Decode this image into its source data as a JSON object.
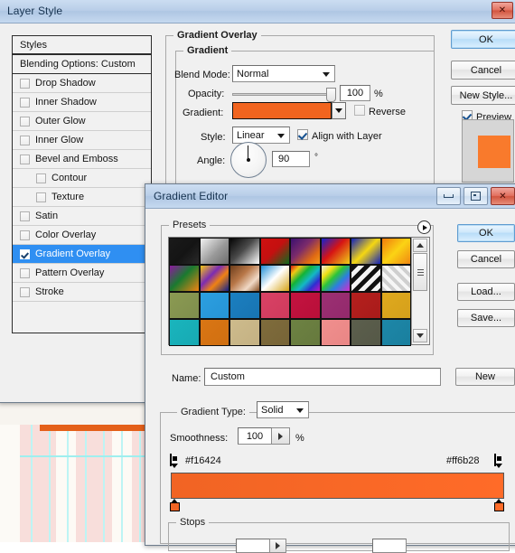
{
  "background": {
    "name": "photoshop-canvas-pinstripe"
  },
  "layer_style": {
    "title": "Layer Style",
    "close_icon": "close-icon",
    "styles_header": "Styles",
    "blending_options": "Blending Options: Custom",
    "effects": [
      {
        "label": "Drop Shadow",
        "checked": false,
        "indent": false
      },
      {
        "label": "Inner Shadow",
        "checked": false,
        "indent": false
      },
      {
        "label": "Outer Glow",
        "checked": false,
        "indent": false
      },
      {
        "label": "Inner Glow",
        "checked": false,
        "indent": false
      },
      {
        "label": "Bevel and Emboss",
        "checked": false,
        "indent": false
      },
      {
        "label": "Contour",
        "checked": false,
        "indent": true
      },
      {
        "label": "Texture",
        "checked": false,
        "indent": true
      },
      {
        "label": "Satin",
        "checked": false,
        "indent": false
      },
      {
        "label": "Color Overlay",
        "checked": false,
        "indent": false
      },
      {
        "label": "Gradient Overlay",
        "checked": true,
        "indent": false,
        "selected": true
      },
      {
        "label": "Pattern Overlay",
        "checked": false,
        "indent": false
      },
      {
        "label": "Stroke",
        "checked": false,
        "indent": false
      }
    ],
    "panel": {
      "group_title": "Gradient Overlay",
      "subgroup_title": "Gradient",
      "blend_mode_label": "Blend Mode:",
      "blend_mode_value": "Normal",
      "opacity_label": "Opacity:",
      "opacity_value": "100",
      "opacity_unit": "%",
      "gradient_label": "Gradient:",
      "gradient_preview_color": "#f1641f",
      "reverse_label": "Reverse",
      "reverse_checked": false,
      "style_label": "Style:",
      "style_value": "Linear",
      "align_label": "Align with Layer",
      "align_checked": true,
      "angle_label": "Angle:",
      "angle_value": "90",
      "angle_unit": "°"
    },
    "buttons": {
      "ok": "OK",
      "cancel": "Cancel",
      "new_style": "New Style...",
      "preview_label": "Preview",
      "preview_checked": true,
      "preview_swatch_color": "#f97a2c"
    }
  },
  "gradient_editor": {
    "title": "Gradient Editor",
    "window_buttons": [
      "minimize-icon",
      "maximize-icon",
      "close-icon"
    ],
    "presets_label": "Presets",
    "presets_menu_icon": "presets-flyout-icon",
    "presets": [
      {
        "name": "black-to-transparent",
        "css": "linear-gradient(135deg,#1a1a1a 0%,#141414 55%,#2a2a2a 100%)"
      },
      {
        "name": "white-to-transparent-checker",
        "css": "linear-gradient(135deg,#f2f2f2 0%,#9a9a9a 55%,#6d6d6d 100%)"
      },
      {
        "name": "black-to-white",
        "css": "linear-gradient(135deg,#060606 0%,#4a4a4a 45%,#ffffff 100%)"
      },
      {
        "name": "red-green",
        "css": "linear-gradient(135deg,#cf1111 0%,#c41010 48%,#0d6b1e 100%)"
      },
      {
        "name": "violet-orange",
        "css": "linear-gradient(135deg,#3b1070 0%,#7b2b6b 40%,#e06a13 75%,#f59a17 100%)"
      },
      {
        "name": "blue-red-yellow",
        "css": "linear-gradient(135deg,#1422cf 0%,#d61414 45%,#f0d017 100%)"
      },
      {
        "name": "blue-yellow-blue",
        "css": "linear-gradient(135deg,#1020bb 0%,#f5d712 50%,#1020bb 100%)"
      },
      {
        "name": "orange-yellow-orange",
        "css": "linear-gradient(135deg,#f07b0d 0%,#fbd314 50%,#f08712 100%)"
      },
      {
        "name": "violet-green-orange",
        "css": "linear-gradient(135deg,#8c1a9e 0%,#1a7a2f 45%,#f08412 100%)"
      },
      {
        "name": "yellow-violet-orange-blue",
        "css": "linear-gradient(135deg,#f4c814 0%,#7b2bb3 38%,#ef8213 62%,#0f1f8c 100%)"
      },
      {
        "name": "copper",
        "css": "linear-gradient(135deg,#6d3d1b 0%,#b87748 40%,#f0d9c6 72%,#8a5126 100%)"
      },
      {
        "name": "blue-white-gold",
        "css": "linear-gradient(135deg,#1e8ed6 0%,#ffffff 48%,#d6a317 100%)"
      },
      {
        "name": "spectrum",
        "css": "linear-gradient(135deg,#d81414 0%,#f0c814 18%,#14b336 38%,#14b8c4 58%,#2e2ed1 78%,#c114c1 100%)"
      },
      {
        "name": "transparent-rainbow",
        "css": "linear-gradient(135deg,#ededed 0%,#f2e014 24%,#2bc43a 44%,#2b7fe0 66%,#d62bcb 100%)"
      },
      {
        "name": "black-white-stripes",
        "css": "repeating-linear-gradient(135deg,#111 0 5px,#f4f4f4 5px 10px)"
      },
      {
        "name": "transparent-stripes",
        "css": "repeating-linear-gradient(45deg,#cfcfcf 0 4px,#f6f6f6 4px 8px)"
      },
      {
        "name": "olive-solid",
        "css": "linear-gradient(135deg,#8b9a52 0%,#7f8e4d 100%)"
      },
      {
        "name": "sky-blue-solid",
        "css": "linear-gradient(135deg,#2c9fe0 0%,#2694d6 100%)"
      },
      {
        "name": "steel-blue-solid",
        "css": "linear-gradient(135deg,#1b7fc0 0%,#1874b2 100%)"
      },
      {
        "name": "rose-solid",
        "css": "linear-gradient(135deg,#d94265 0%,#cf3a5d 100%)"
      },
      {
        "name": "crimson-solid",
        "css": "linear-gradient(135deg,#c41340 0%,#b80f39 100%)"
      },
      {
        "name": "magenta-solid",
        "css": "linear-gradient(135deg,#9c3073 0%,#93296c 100%)"
      },
      {
        "name": "dark-red-solid",
        "css": "linear-gradient(135deg,#b5201e 0%,#a81b1a 100%)"
      },
      {
        "name": "gold-solid",
        "css": "linear-gradient(135deg,#dfa91e 0%,#d5a01b 100%)"
      },
      {
        "name": "teal-solid",
        "css": "linear-gradient(135deg,#19b5bd 0%,#18a9b3 100%)"
      },
      {
        "name": "orange-solid",
        "css": "linear-gradient(135deg,#da7614 0%,#d06f11 100%)"
      },
      {
        "name": "tan-solid",
        "css": "linear-gradient(135deg,#cdbb8c 0%,#c4b183 100%)"
      },
      {
        "name": "brown-solid",
        "css": "linear-gradient(135deg,#7f6c3c 0%,#776437 100%)"
      },
      {
        "name": "moss-solid",
        "css": "linear-gradient(135deg,#6d8243 0%,#66793d 100%)"
      },
      {
        "name": "salmon-solid",
        "css": "linear-gradient(135deg,#f08f8e 0%,#e98685 100%)"
      },
      {
        "name": "slate-solid",
        "css": "linear-gradient(135deg,#5c5f4d 0%,#555847 100%)"
      },
      {
        "name": "ocean-solid",
        "css": "linear-gradient(135deg,#1d87a8 0%,#1a7f9e 100%)"
      }
    ],
    "scrollbar": {
      "up_icon": "scroll-up-arrow-icon",
      "down_icon": "scroll-down-arrow-icon",
      "thumb_icon": "scroll-thumb-grip"
    },
    "name_label": "Name:",
    "name_value": "Custom",
    "new_button": "New",
    "gradient_type_label": "Gradient Type:",
    "gradient_type_value": "Solid",
    "smoothness_label": "Smoothness:",
    "smoothness_value": "100",
    "smoothness_unit": "%",
    "stops_group_label": "Stops",
    "gradient": {
      "left_stop_hex": "#f16424",
      "right_stop_hex": "#ff6b28",
      "bar_css": "linear-gradient(90deg,#f16424 0%,#ff6b28 100%)"
    },
    "buttons": {
      "ok": "OK",
      "cancel": "Cancel",
      "load": "Load...",
      "save": "Save..."
    }
  }
}
